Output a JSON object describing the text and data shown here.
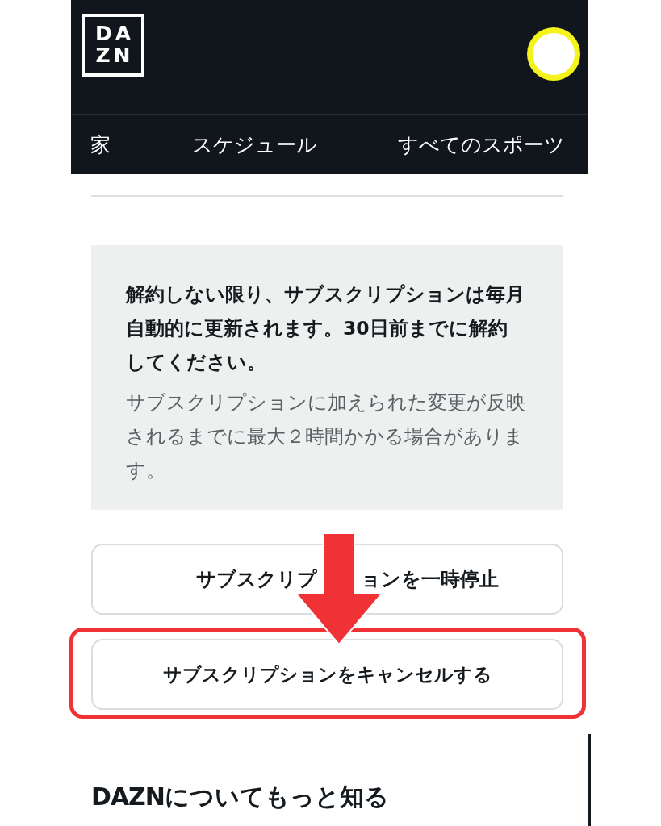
{
  "header": {
    "logo": {
      "top": "DA",
      "bottom": "ZN"
    }
  },
  "nav": [
    {
      "label": "家"
    },
    {
      "label": "スケジュール"
    },
    {
      "label": "すべてのスポーツ"
    }
  ],
  "notice": {
    "bold_text": "解約しない限り、サブスクリプションは毎月自動的に更新されます。30日前までに解約してください。",
    "text": "サブスクリプションに加えられた変更が反映されるまでに最大２時間かかる場合があります。"
  },
  "buttons": [
    {
      "label_parts": [
        "サブスクリプ",
        "ョンを一時停止"
      ],
      "highlighted": false
    },
    {
      "label": "サブスクリプションをキャンセルする",
      "highlighted": true
    }
  ],
  "footer": {
    "heading_brand": "DAZN",
    "heading": "についてもっと知る"
  }
}
